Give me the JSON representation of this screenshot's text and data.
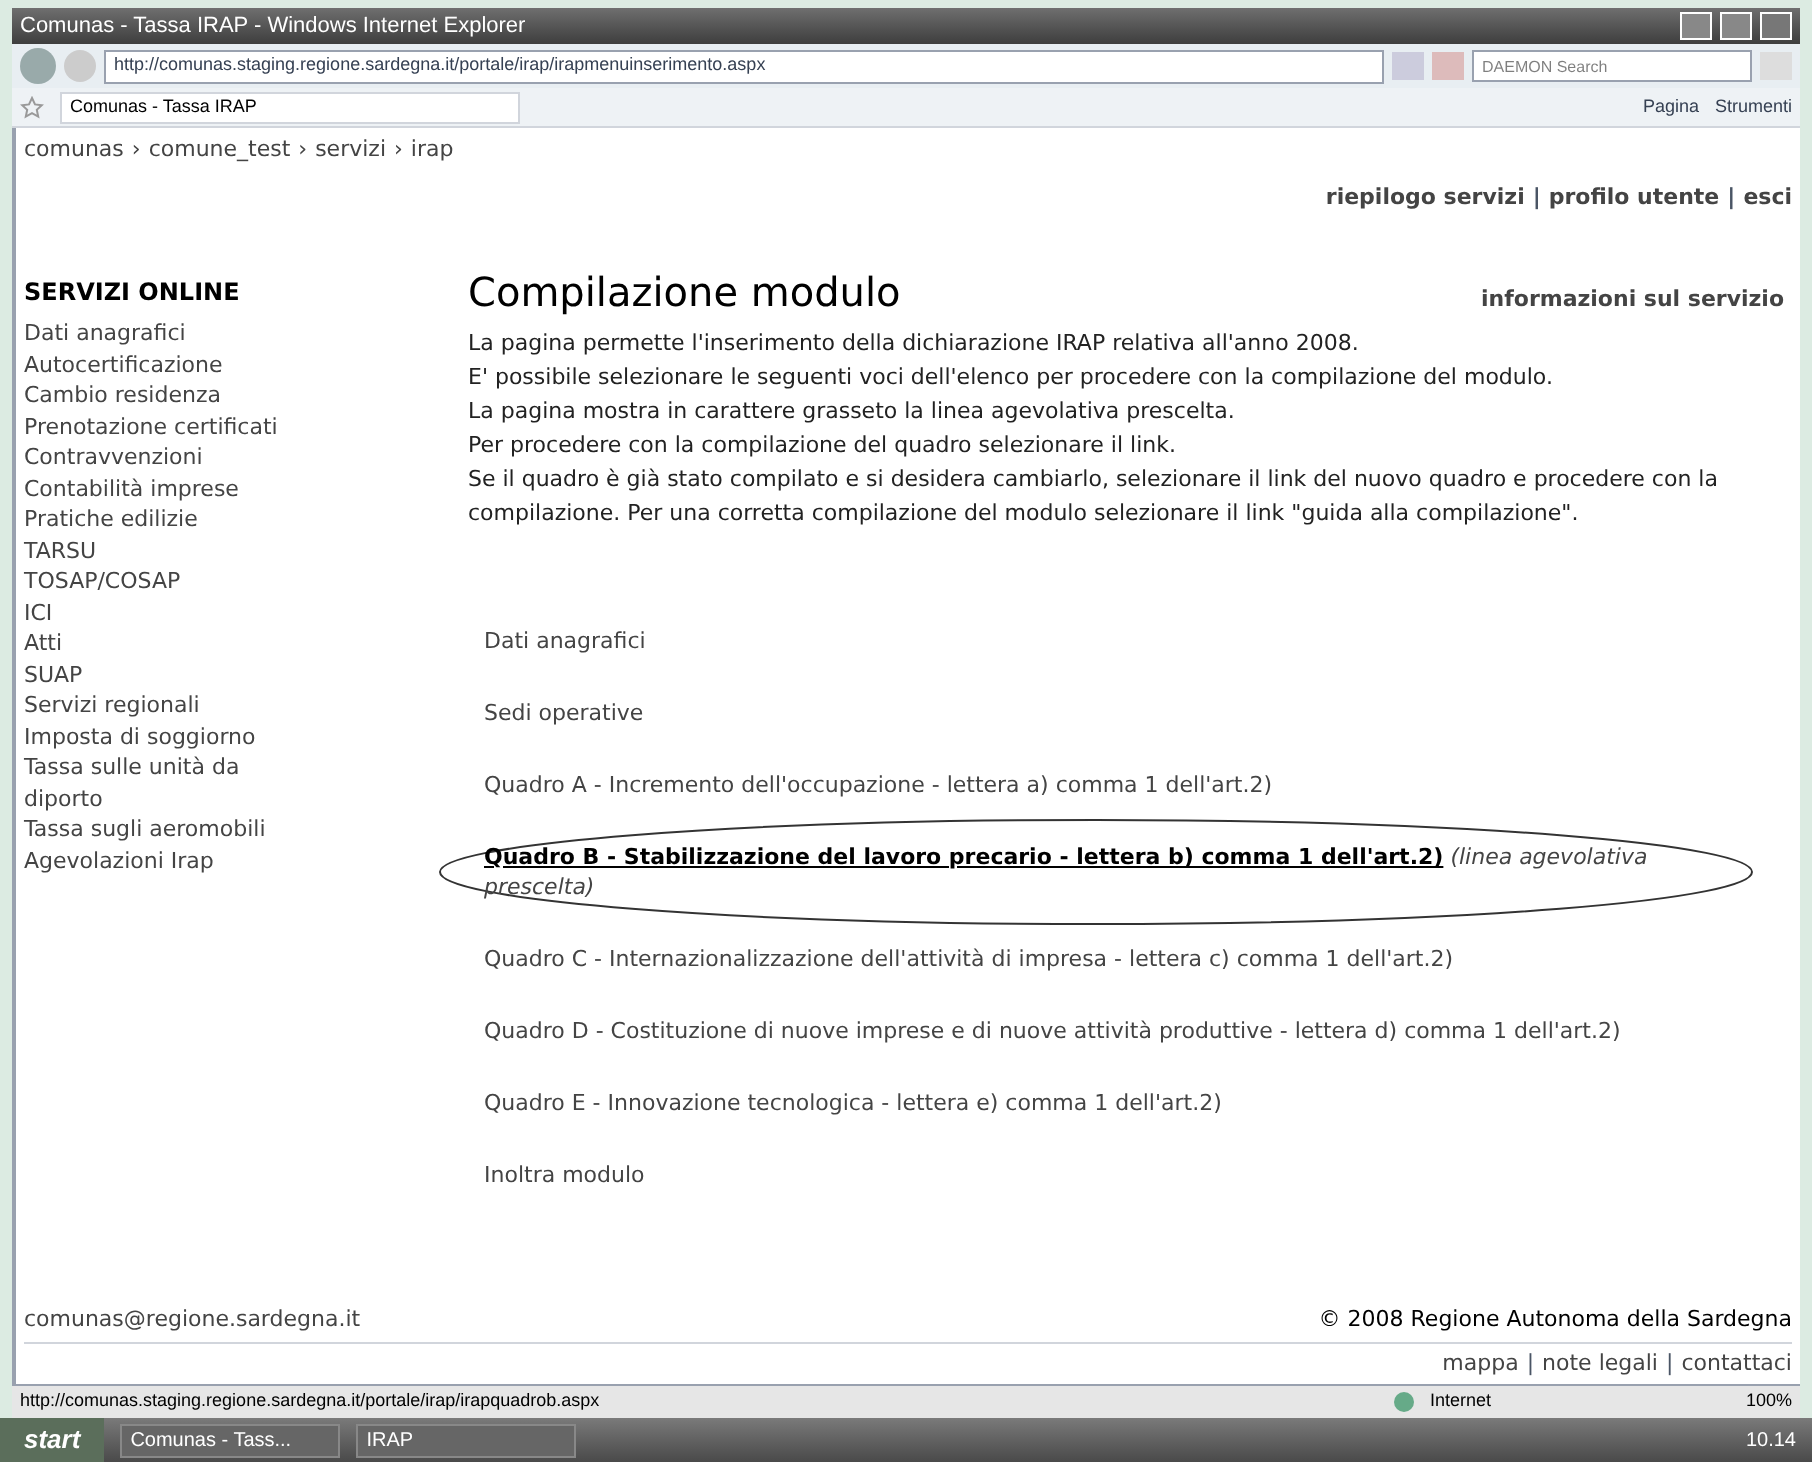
{
  "window": {
    "title": "Comunas - Tassa IRAP - Windows Internet Explorer"
  },
  "browser": {
    "address": "http://comunas.staging.regione.sardegna.it/portale/irap/irapmenuinserimento.aspx",
    "search_placeholder": "DAEMON Search",
    "tab": "Comunas - Tassa IRAP",
    "tools": [
      "Pagina",
      "Strumenti"
    ]
  },
  "breadcrumb": [
    "comunas",
    "comune_test",
    "servizi",
    "irap"
  ],
  "breadcrumb_separator": "›",
  "link_separator": "|",
  "top_links": [
    "riepilogo servizi",
    "profilo utente",
    "esci"
  ],
  "sidebar": {
    "title": "SERVIZI ONLINE",
    "items": [
      "Dati anagrafici",
      "Autocertificazione",
      "Cambio residenza",
      "Prenotazione certificati",
      "Contravvenzioni",
      "Contabilità imprese",
      "Pratiche edilizie",
      "TARSU",
      "TOSAP/COSAP",
      "ICI",
      "Atti",
      "SUAP",
      "Servizi regionali",
      "Imposta di soggiorno",
      "Tassa sulle unità da diporto",
      "Tassa sugli aeromobili",
      "Agevolazioni Irap"
    ]
  },
  "main": {
    "title": "Compilazione modulo",
    "info_link": "informazioni sul servizio",
    "intro": [
      "La pagina permette l'inserimento della dichiarazione IRAP relativa all'anno 2008.",
      "E' possibile selezionare le seguenti voci dell'elenco per procedere con la compilazione del modulo.",
      "La pagina mostra in carattere grasseto la linea agevolativa prescelta.",
      "Per procedere con la compilazione del quadro selezionare il link.",
      "Se il quadro è già stato compilato e si desidera cambiarlo, selezionare il link del nuovo quadro e procedere con la compilazione. Per una corretta compilazione del modulo selezionare il link \"guida alla compilazione\"."
    ],
    "options": [
      {
        "label": "Dati anagrafici",
        "selected": false
      },
      {
        "label": "Sedi operative",
        "selected": false
      },
      {
        "label": "Quadro A - Incremento dell'occupazione - lettera a) comma 1 dell'art.2)",
        "selected": false
      },
      {
        "label": "Quadro B - Stabilizzazione del lavoro precario - lettera b) comma 1 dell'art.2)",
        "selected": true,
        "note": "(linea agevolativa prescelta)"
      },
      {
        "label": "Quadro C - Internazionalizzazione dell'attività di impresa - lettera c) comma 1 dell'art.2)",
        "selected": false
      },
      {
        "label": "Quadro D - Costituzione di nuove imprese e di nuove attività produttive - lettera d) comma 1 dell'art.2)",
        "selected": false
      },
      {
        "label": "Quadro E - Innovazione tecnologica - lettera e) comma 1 dell'art.2)",
        "selected": false
      },
      {
        "label": "Inoltra modulo",
        "selected": false
      }
    ]
  },
  "footer": {
    "email": "comunas@regione.sardegna.it",
    "copyright": "© 2008 Regione Autonoma della Sardegna",
    "links": [
      "mappa",
      "note legali",
      "contattaci"
    ]
  },
  "status_bar": {
    "url": "http://comunas.staging.regione.sardegna.it/portale/irap/irapquadrob.aspx",
    "zone": "Internet",
    "zoom": "100%"
  },
  "taskbar": {
    "start": "start",
    "tasks": [
      "Comunas - Tass...",
      "IRAP"
    ],
    "time": "10.14"
  }
}
